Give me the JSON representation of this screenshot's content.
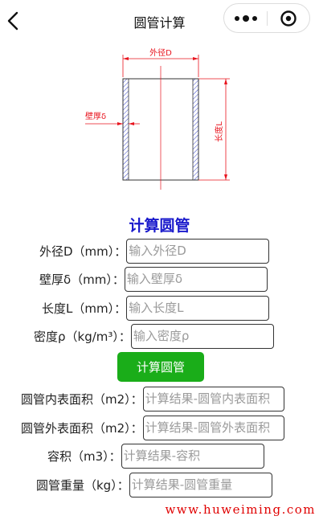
{
  "header": {
    "title": "圆管计算"
  },
  "diagram": {
    "outer_label": "外径D",
    "wall_label": "壁厚δ",
    "length_label": "长度L"
  },
  "section_title": "计算圆管",
  "form": {
    "outer_diameter": {
      "label": "外径D（mm）：",
      "placeholder": "输入外径D"
    },
    "wall_thickness": {
      "label": "壁厚δ（mm）：",
      "placeholder": "输入壁厚δ"
    },
    "length": {
      "label": "长度L（mm）：",
      "placeholder": "输入长度L"
    },
    "density": {
      "label": "密度ρ（kg/m³）：",
      "placeholder": "输入密度ρ"
    }
  },
  "calc_button": "计算圆管",
  "results": {
    "inner_surface": {
      "label": "圆管内表面积（m2）：",
      "placeholder": "计算结果-圆管内表面积"
    },
    "outer_surface": {
      "label": "圆管外表面积（m2）：",
      "placeholder": "计算结果-圆管外表面积"
    },
    "volume": {
      "label": "容积（m3）：",
      "placeholder": "计算结果-容积"
    },
    "weight": {
      "label": "圆管重量（kg）：",
      "placeholder": "计算结果-圆管重量"
    }
  },
  "footer": "www.huweiming.com",
  "colors": {
    "accent_button": "#1aad19",
    "section_title": "#1a1acc",
    "footer": "#e00000",
    "diagram_red": "#e8141e",
    "diagram_hatch": "#3a46c8"
  },
  "icons": {
    "back": "chevron-left-icon",
    "more": "more-dots-icon",
    "close": "target-circle-icon"
  }
}
